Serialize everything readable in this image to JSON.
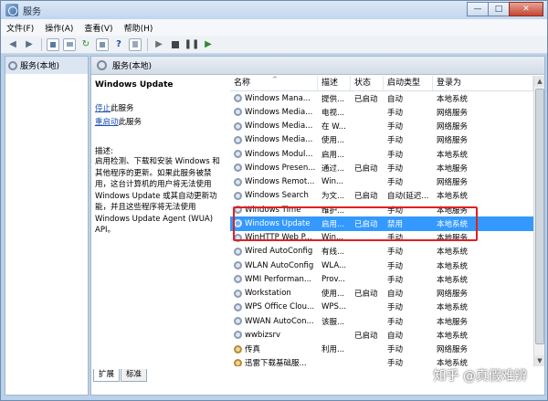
{
  "window": {
    "title": "服务",
    "min": "—",
    "max": "□",
    "close": "✕"
  },
  "menu": [
    "文件(F)",
    "操作(A)",
    "查看(V)",
    "帮助(H)"
  ],
  "tree": {
    "root": "服务(本地)"
  },
  "pane": {
    "title": "服务(本地)"
  },
  "description": {
    "service_name": "Windows Update",
    "stop_link": "停止",
    "stop_suffix": "此服务",
    "restart_link": "重启动",
    "restart_suffix": "此服务",
    "label": "描述:",
    "text": "启用检测、下载和安装 Windows 和其他程序的更新。如果此服务被禁用，这台计算机的用户将无法使用 Windows Update 或其自动更新功能，并且这些程序将无法使用 Windows Update Agent (WUA) API。"
  },
  "table": {
    "columns": [
      "名称",
      "描述",
      "状态",
      "启动类型",
      "登录为"
    ],
    "sort_indicator": "^",
    "rows": [
      {
        "name": "Windows Mana...",
        "desc": "提供...",
        "status": "已启动",
        "startup": "自动",
        "logon": "本地系统"
      },
      {
        "name": "Windows Media...",
        "desc": "电视...",
        "status": "",
        "startup": "手动",
        "logon": "网络服务"
      },
      {
        "name": "Windows Media...",
        "desc": "在 W...",
        "status": "",
        "startup": "手动",
        "logon": "网络服务"
      },
      {
        "name": "Windows Media...",
        "desc": "使用...",
        "status": "",
        "startup": "手动",
        "logon": "网络服务"
      },
      {
        "name": "Windows Modul...",
        "desc": "启用...",
        "status": "",
        "startup": "手动",
        "logon": "本地系统"
      },
      {
        "name": "Windows Presen...",
        "desc": "通过...",
        "status": "已启动",
        "startup": "手动",
        "logon": "本地服务"
      },
      {
        "name": "Windows Remot...",
        "desc": "Win...",
        "status": "",
        "startup": "手动",
        "logon": "网络服务"
      },
      {
        "name": "Windows Search",
        "desc": "为文...",
        "status": "已启动",
        "startup": "自动(延迟...",
        "logon": "本地系统"
      },
      {
        "name": "Windows Time",
        "desc": "维护...",
        "status": "",
        "startup": "手动",
        "logon": "本地服务"
      },
      {
        "name": "Windows Update",
        "desc": "启用...",
        "status": "已启动",
        "startup": "禁用",
        "logon": "本地系统",
        "selected": true
      },
      {
        "name": "WinHTTP Web P...",
        "desc": "Win...",
        "status": "",
        "startup": "手动",
        "logon": "本地服务"
      },
      {
        "name": "Wired AutoConfig",
        "desc": "有线...",
        "status": "",
        "startup": "手动",
        "logon": "本地系统"
      },
      {
        "name": "WLAN AutoConfig",
        "desc": "WLA...",
        "status": "",
        "startup": "手动",
        "logon": "本地系统"
      },
      {
        "name": "WMI Performan...",
        "desc": "Prov...",
        "status": "",
        "startup": "手动",
        "logon": "本地系统"
      },
      {
        "name": "Workstation",
        "desc": "使用...",
        "status": "已启动",
        "startup": "自动",
        "logon": "网络服务"
      },
      {
        "name": "WPS Office Clou...",
        "desc": "WPS...",
        "status": "",
        "startup": "手动",
        "logon": "本地系统"
      },
      {
        "name": "WWAN AutoCon...",
        "desc": "该服...",
        "status": "",
        "startup": "手动",
        "logon": "本地服务"
      },
      {
        "name": "wwbizsrv",
        "desc": "",
        "status": "已启动",
        "startup": "自动",
        "logon": "本地系统"
      },
      {
        "name": "传真",
        "desc": "利用...",
        "status": "",
        "startup": "手动",
        "logon": "网络服务"
      },
      {
        "name": "迅雷下载基础服...",
        "desc": "",
        "status": "",
        "startup": "手动",
        "logon": "本地系统"
      }
    ]
  },
  "tabs": [
    "扩展",
    "标准"
  ],
  "watermark": "知乎 @真假难辨"
}
